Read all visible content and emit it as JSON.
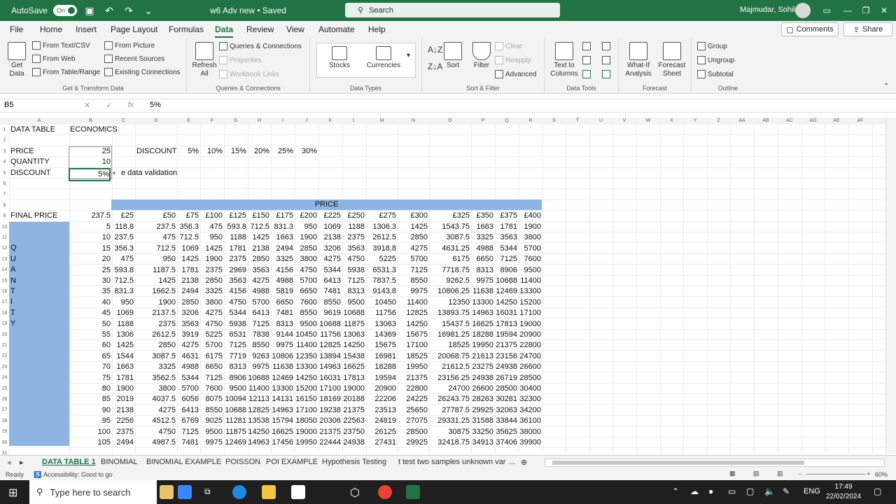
{
  "titlebar": {
    "autosave_label": "AutoSave",
    "toggle_label": "On",
    "doc_title": "w6 Adv new • Saved",
    "search_placeholder": "Search",
    "user_name": "Majmudar, Sohil"
  },
  "menu": {
    "items": [
      "File",
      "Home",
      "Insert",
      "Page Layout",
      "Formulas",
      "Data",
      "Review",
      "View",
      "Automate",
      "Help"
    ],
    "active": "Data",
    "comments_label": "Comments",
    "share_label": "Share"
  },
  "ribbon": {
    "get_transform": {
      "get_data": "Get Data",
      "from_text_csv": "From Text/CSV",
      "from_web": "From Web",
      "from_table_range": "From Table/Range",
      "from_picture": "From Picture",
      "recent_sources": "Recent Sources",
      "existing_connections": "Existing Connections",
      "group_label": "Get & Transform Data"
    },
    "queries": {
      "refresh_all": "Refresh All",
      "queries_connections": "Queries & Connections",
      "properties": "Properties",
      "workbook_links": "Workbook Links",
      "group_label": "Queries & Connections"
    },
    "data_types": {
      "stocks": "Stocks",
      "currencies": "Currencies",
      "group_label": "Data Types"
    },
    "sort_filter": {
      "sort": "Sort",
      "filter": "Filter",
      "clear": "Clear",
      "reapply": "Reapply",
      "advanced": "Advanced",
      "group_label": "Sort & Filter"
    },
    "data_tools": {
      "text_to_columns": "Text to Columns",
      "group_label": "Data Tools"
    },
    "forecast": {
      "what_if": "What-If Analysis",
      "forecast_sheet": "Forecast Sheet",
      "group_label": "Forecast"
    },
    "outline": {
      "group": "Group",
      "ungroup": "Ungroup",
      "subtotal": "Subtotal",
      "group_label": "Outline"
    }
  },
  "formula_bar": {
    "name_box": "B5",
    "content": "5%"
  },
  "columns": [
    "A",
    "B",
    "C",
    "D",
    "E",
    "F",
    "G",
    "H",
    "I",
    "J",
    "K",
    "L",
    "M",
    "N",
    "O",
    "P",
    "Q",
    "R",
    "S",
    "T",
    "U",
    "V",
    "W",
    "X",
    "Y",
    "Z",
    "AA",
    "AB",
    "AC",
    "AD",
    "AE",
    "AF"
  ],
  "sheet": {
    "a1": "DATA TABLE",
    "b1": "ECONOMICS",
    "a3": "PRICE",
    "b3": "25",
    "a4": "QUANTITY",
    "b4": "10",
    "a5": "DISCOUNT",
    "b5": "5%",
    "d3": "DISCOUNT",
    "discounts": [
      "5%",
      "10%",
      "15%",
      "20%",
      "25%",
      "30%"
    ],
    "c5_text": "e data validation",
    "price_band": "PRICE",
    "a9": "FINAL PRICE",
    "b9": "237.5",
    "price_headers": [
      "£25",
      "£50",
      "£75",
      "£100",
      "£125",
      "£150",
      "£175",
      "£200",
      "£225",
      "£250",
      "£275",
      "£300",
      "£325",
      "£350",
      "£375",
      "£400"
    ],
    "qty_label_letters": [
      "Q",
      "U",
      "A",
      "N",
      "T",
      "I",
      "T",
      "Y"
    ],
    "rows": [
      {
        "q": "5",
        "v": [
          "118.8",
          "237.5",
          "356.3",
          "475",
          "593.8",
          "712.5",
          "831.3",
          "950",
          "1069",
          "1188",
          "1306.3",
          "1425",
          "1543.75",
          "1663",
          "1781",
          "1900"
        ]
      },
      {
        "q": "10",
        "v": [
          "237.5",
          "475",
          "712.5",
          "950",
          "1188",
          "1425",
          "1663",
          "1900",
          "2138",
          "2375",
          "2612.5",
          "2850",
          "3087.5",
          "3325",
          "3563",
          "3800"
        ]
      },
      {
        "q": "15",
        "v": [
          "356.3",
          "712.5",
          "1069",
          "1425",
          "1781",
          "2138",
          "2494",
          "2850",
          "3206",
          "3563",
          "3918.8",
          "4275",
          "4631.25",
          "4988",
          "5344",
          "5700"
        ]
      },
      {
        "q": "20",
        "v": [
          "475",
          "950",
          "1425",
          "1900",
          "2375",
          "2850",
          "3325",
          "3800",
          "4275",
          "4750",
          "5225",
          "5700",
          "6175",
          "6650",
          "7125",
          "7600"
        ]
      },
      {
        "q": "25",
        "v": [
          "593.8",
          "1187.5",
          "1781",
          "2375",
          "2969",
          "3563",
          "4156",
          "4750",
          "5344",
          "5938",
          "6531.3",
          "7125",
          "7718.75",
          "8313",
          "8906",
          "9500"
        ]
      },
      {
        "q": "30",
        "v": [
          "712.5",
          "1425",
          "2138",
          "2850",
          "3563",
          "4275",
          "4988",
          "5700",
          "6413",
          "7125",
          "7837.5",
          "8550",
          "9262.5",
          "9975",
          "10688",
          "11400"
        ]
      },
      {
        "q": "35",
        "v": [
          "831.3",
          "1662.5",
          "2494",
          "3325",
          "4156",
          "4988",
          "5819",
          "6650",
          "7481",
          "8313",
          "9143.8",
          "9975",
          "10806.25",
          "11638",
          "12469",
          "13300"
        ]
      },
      {
        "q": "40",
        "v": [
          "950",
          "1900",
          "2850",
          "3800",
          "4750",
          "5700",
          "6650",
          "7600",
          "8550",
          "9500",
          "10450",
          "11400",
          "12350",
          "13300",
          "14250",
          "15200"
        ]
      },
      {
        "q": "45",
        "v": [
          "1069",
          "2137.5",
          "3206",
          "4275",
          "5344",
          "6413",
          "7481",
          "8550",
          "9619",
          "10688",
          "11756",
          "12825",
          "13893.75",
          "14963",
          "16031",
          "17100"
        ]
      },
      {
        "q": "50",
        "v": [
          "1188",
          "2375",
          "3563",
          "4750",
          "5938",
          "7125",
          "8313",
          "9500",
          "10688",
          "11875",
          "13063",
          "14250",
          "15437.5",
          "16625",
          "17813",
          "19000"
        ]
      },
      {
        "q": "55",
        "v": [
          "1306",
          "2612.5",
          "3919",
          "5225",
          "6531",
          "7838",
          "9144",
          "10450",
          "11756",
          "13063",
          "14369",
          "15675",
          "16981.25",
          "18288",
          "19594",
          "20900"
        ]
      },
      {
        "q": "60",
        "v": [
          "1425",
          "2850",
          "4275",
          "5700",
          "7125",
          "8550",
          "9975",
          "11400",
          "12825",
          "14250",
          "15675",
          "17100",
          "18525",
          "19950",
          "21375",
          "22800"
        ]
      },
      {
        "q": "65",
        "v": [
          "1544",
          "3087.5",
          "4631",
          "6175",
          "7719",
          "9263",
          "10806",
          "12350",
          "13894",
          "15438",
          "16981",
          "18525",
          "20068.75",
          "21613",
          "23156",
          "24700"
        ]
      },
      {
        "q": "70",
        "v": [
          "1663",
          "3325",
          "4988",
          "6650",
          "8313",
          "9975",
          "11638",
          "13300",
          "14963",
          "16625",
          "18288",
          "19950",
          "21612.5",
          "23275",
          "24938",
          "26600"
        ]
      },
      {
        "q": "75",
        "v": [
          "1781",
          "3562.5",
          "5344",
          "7125",
          "8906",
          "10688",
          "12469",
          "14250",
          "16031",
          "17813",
          "19594",
          "21375",
          "23156.25",
          "24938",
          "26719",
          "28500"
        ]
      },
      {
        "q": "80",
        "v": [
          "1900",
          "3800",
          "5700",
          "7600",
          "9500",
          "11400",
          "13300",
          "15200",
          "17100",
          "19000",
          "20900",
          "22800",
          "24700",
          "26600",
          "28500",
          "30400"
        ]
      },
      {
        "q": "85",
        "v": [
          "2019",
          "4037.5",
          "6056",
          "8075",
          "10094",
          "12113",
          "14131",
          "16150",
          "18169",
          "20188",
          "22206",
          "24225",
          "26243.75",
          "28263",
          "30281",
          "32300"
        ]
      },
      {
        "q": "90",
        "v": [
          "2138",
          "4275",
          "6413",
          "8550",
          "10688",
          "12825",
          "14963",
          "17100",
          "19238",
          "21375",
          "23513",
          "25650",
          "27787.5",
          "29925",
          "32063",
          "34200"
        ]
      },
      {
        "q": "95",
        "v": [
          "2256",
          "4512.5",
          "6769",
          "9025",
          "11281",
          "13538",
          "15794",
          "18050",
          "20306",
          "22563",
          "24819",
          "27075",
          "29331.25",
          "31588",
          "33844",
          "36100"
        ]
      },
      {
        "q": "100",
        "v": [
          "2375",
          "4750",
          "7125",
          "9500",
          "11875",
          "14250",
          "16625",
          "19000",
          "21375",
          "23750",
          "26125",
          "28500",
          "30875",
          "33250",
          "35625",
          "38000"
        ]
      },
      {
        "q": "105",
        "v": [
          "2494",
          "4987.5",
          "7481",
          "9975",
          "12469",
          "14963",
          "17456",
          "19950",
          "22444",
          "24938",
          "27431",
          "29925",
          "32418.75",
          "34913",
          "37406",
          "39900"
        ]
      }
    ]
  },
  "sheet_tabs": [
    "DATA TABLE 1",
    "BINOMIAL",
    "BINOMIAL EXAMPLE",
    "POISSON",
    "POI EXAMPLE",
    "Hypothesis Testing",
    "t test two samples unknown var",
    "..."
  ],
  "status": {
    "ready": "Ready",
    "accessibility": "Accessibility: Good to go",
    "zoom": "60%"
  },
  "taskbar": {
    "search_placeholder": "Type here to search",
    "language": "ENG",
    "time": "17:49",
    "date": "22/02/2024"
  }
}
